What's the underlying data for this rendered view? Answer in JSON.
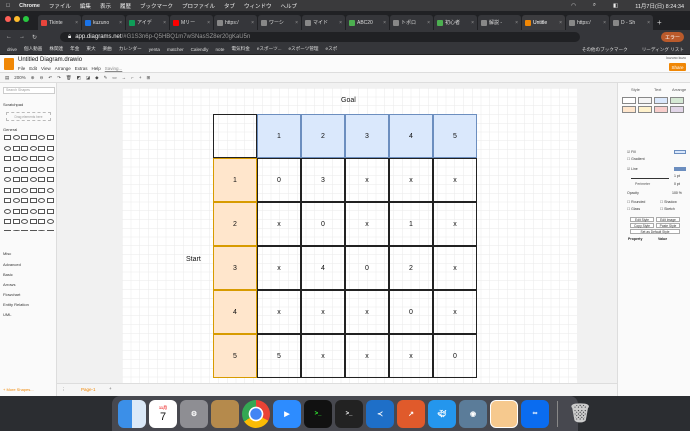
{
  "menubar": {
    "app": "Chrome",
    "items": [
      "ファイル",
      "編集",
      "表示",
      "履歴",
      "ブックマーク",
      "プロファイル",
      "タブ",
      "ウィンドウ",
      "ヘルプ"
    ],
    "datetime": "11月7日(日)  8:24:34"
  },
  "tabs": [
    {
      "label": "Tkinte",
      "color": "#e8453c"
    },
    {
      "label": "kuzuno",
      "color": "#1a73e8"
    },
    {
      "label": "アイデ",
      "color": "#0f9d58"
    },
    {
      "label": "Mリー",
      "color": "#ff0000"
    },
    {
      "label": "https:/",
      "color": "#888888"
    },
    {
      "label": "ワーシ",
      "color": "#888888"
    },
    {
      "label": "マイド",
      "color": "#888888"
    },
    {
      "label": "ABC20",
      "color": "#4caf50"
    },
    {
      "label": "トポロ",
      "color": "#888888"
    },
    {
      "label": "初心者",
      "color": "#4caf50"
    },
    {
      "label": "解説 -",
      "color": "#888888"
    },
    {
      "label": "Untitle",
      "color": "#f08705",
      "active": true
    },
    {
      "label": "https:/",
      "color": "#888888"
    },
    {
      "label": "D - Sh",
      "color": "#888888"
    }
  ],
  "address": {
    "url_host": "app.diagrams.net",
    "url_rest": "/#G1S3n6p-Q5HBQ1m7wSNasSZ8er20gKaU5n",
    "error_button": "エラー"
  },
  "bookmarks": [
    "drive",
    "個人動画",
    "株関連",
    "年金",
    "東大",
    "楽曲",
    "カレンダー",
    "yenta",
    "matcher",
    "Calendly",
    "note",
    "電気料金",
    "eスポーツ...",
    "eスポーツ管理",
    "eスポ"
  ],
  "bookmarks_right": [
    "その他のブックマーク",
    "リーディング リスト"
  ],
  "app": {
    "doc_title": "Untitled Diagram.drawio",
    "menu": [
      "File",
      "Edit",
      "View",
      "Arrange",
      "Extras",
      "Help",
      "Saving..."
    ],
    "share_label": "Share",
    "zoom": "200%",
    "language_label": "kuzuno kuzu"
  },
  "left_panel": {
    "search_placeholder": "Search Shapes",
    "scratchpad": "Scratchpad",
    "drag_hint": "Drag elements here",
    "general": "General",
    "sections": [
      "Misc",
      "Advanced",
      "Basic",
      "Arrows",
      "Flowchart",
      "Entity Relation",
      "UML"
    ],
    "more_shapes": "+ More Shapes..."
  },
  "page_tab": "Page-1",
  "right_panel": {
    "tabs": [
      "Style",
      "Text",
      "Arrange"
    ],
    "fill": "Fill",
    "gradient": "Gradient",
    "line": "Line",
    "perimeter": "Perimeter",
    "perimeter_value": "0 pt",
    "line_width": "1 pt",
    "opacity": "Opacity",
    "opacity_value": "100 %",
    "rounded": "Rounded",
    "shadow": "Shadow",
    "glass": "Glass",
    "sketch": "Sketch",
    "buttons": [
      "Edit Style",
      "Edit Image",
      "Copy Style",
      "Paste Style",
      "Set as Default Style"
    ],
    "property": "Property",
    "value": "Value"
  },
  "diagram": {
    "goal_label": "Goal",
    "start_label": "Start",
    "column_headers": [
      "1",
      "2",
      "3",
      "4",
      "5"
    ],
    "row_headers": [
      "1",
      "2",
      "3",
      "4",
      "5"
    ],
    "cells": [
      [
        "0",
        "3",
        "x",
        "x",
        "x"
      ],
      [
        "x",
        "0",
        "x",
        "1",
        "x"
      ],
      [
        "x",
        "4",
        "0",
        "2",
        "x"
      ],
      [
        "x",
        "x",
        "x",
        "0",
        "x"
      ],
      [
        "5",
        "x",
        "x",
        "x",
        "0"
      ]
    ]
  },
  "dock": {
    "calendar_month": "11月",
    "calendar_day": "7"
  }
}
